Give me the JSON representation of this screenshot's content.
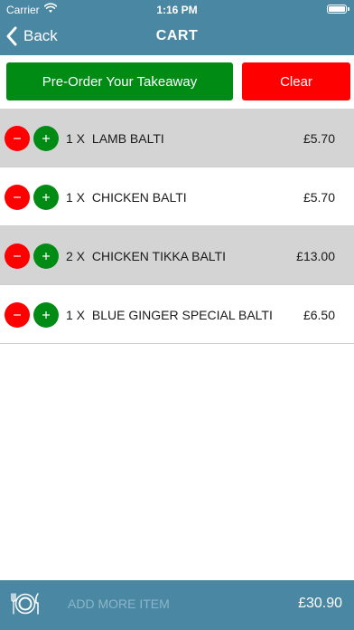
{
  "status_bar": {
    "carrier": "Carrier",
    "time": "1:16 PM"
  },
  "nav": {
    "back_label": "Back",
    "title": "CART"
  },
  "actions": {
    "preorder_label": "Pre-Order Your Takeaway",
    "clear_label": "Clear"
  },
  "cart": {
    "items": [
      {
        "qty": "1 X",
        "name": "LAMB BALTI",
        "price": "£5.70"
      },
      {
        "qty": "1 X",
        "name": "CHICKEN BALTI",
        "price": "£5.70"
      },
      {
        "qty": "2 X",
        "name": "CHICKEN TIKKA BALTI",
        "price": "£13.00"
      },
      {
        "qty": "1 X",
        "name": "BLUE GINGER SPECIAL BALTI",
        "price": "£6.50"
      }
    ]
  },
  "footer": {
    "add_more_label": "ADD MORE ITEM",
    "total": "£30.90"
  },
  "colors": {
    "header_bg": "#4a87a3",
    "preorder_bg": "#008c14",
    "clear_bg": "#ff0000",
    "row_shaded": "#d4d4d4"
  }
}
